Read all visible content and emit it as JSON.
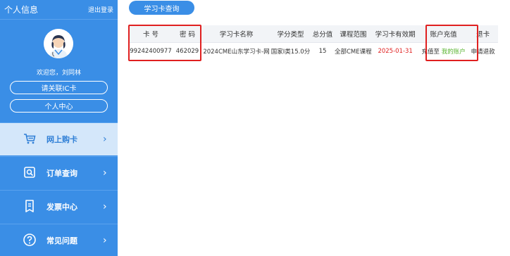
{
  "sidebar": {
    "title": "个人信息",
    "logout": "退出登录",
    "welcome": "欢迎您，刘同林",
    "btn_bind_ic": "请关联IC卡",
    "btn_personal_center": "个人中心",
    "menu": [
      {
        "label": "网上购卡",
        "icon": "cart-icon"
      },
      {
        "label": "订单查询",
        "icon": "order-search-icon"
      },
      {
        "label": "发票中心",
        "icon": "invoice-icon"
      },
      {
        "label": "常见问题",
        "icon": "help-icon"
      }
    ]
  },
  "main": {
    "tab_label": "学习卡查询",
    "table": {
      "headers": [
        "卡 号",
        "密 码",
        "学习卡名称",
        "学分类型",
        "总分值",
        "课程范围",
        "学习卡有效期",
        "账户充值",
        "退卡"
      ],
      "row": {
        "card_no": "99242400977",
        "password": "462029",
        "card_name": "2024CME山东学习卡-网",
        "credit_type": "国家I类15.0分",
        "total_score": "15",
        "course_scope": "全部CME课程",
        "expiry": "2025-01-31",
        "recharge_prefix": "充值至",
        "recharge_link": "我的账户",
        "refund": "申请退款"
      }
    }
  },
  "colors": {
    "primary": "#3a8ee6",
    "active_menu_bg": "#d4e7fa",
    "highlight_red": "#e02020",
    "link_green": "#5bb533"
  }
}
